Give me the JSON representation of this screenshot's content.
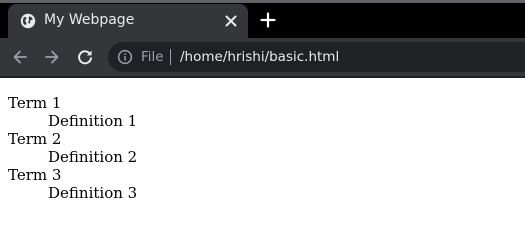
{
  "tab": {
    "title": "My Webpage",
    "close_icon": "close-icon",
    "favicon": "globe-icon"
  },
  "new_tab_icon": "plus-icon",
  "toolbar": {
    "back_icon": "arrow-left-icon",
    "forward_icon": "arrow-right-icon",
    "reload_icon": "reload-icon"
  },
  "omnibox": {
    "info_icon": "info-icon",
    "scheme_label": "File",
    "url": "/home/hrishi/basic.html"
  },
  "colors": {
    "tabstrip_bg": "#000000",
    "active_tab_bg": "#35363a",
    "toolbar_bg": "#35363a",
    "omnibox_bg": "#202124",
    "text_light": "#e8eaed",
    "text_muted": "#9aa0a6",
    "page_bg": "#ffffff"
  },
  "page": {
    "definitions": [
      {
        "term": "Term 1",
        "definition": "Definition 1"
      },
      {
        "term": "Term 2",
        "definition": "Definition 2"
      },
      {
        "term": "Term 3",
        "definition": "Definition 3"
      }
    ]
  }
}
